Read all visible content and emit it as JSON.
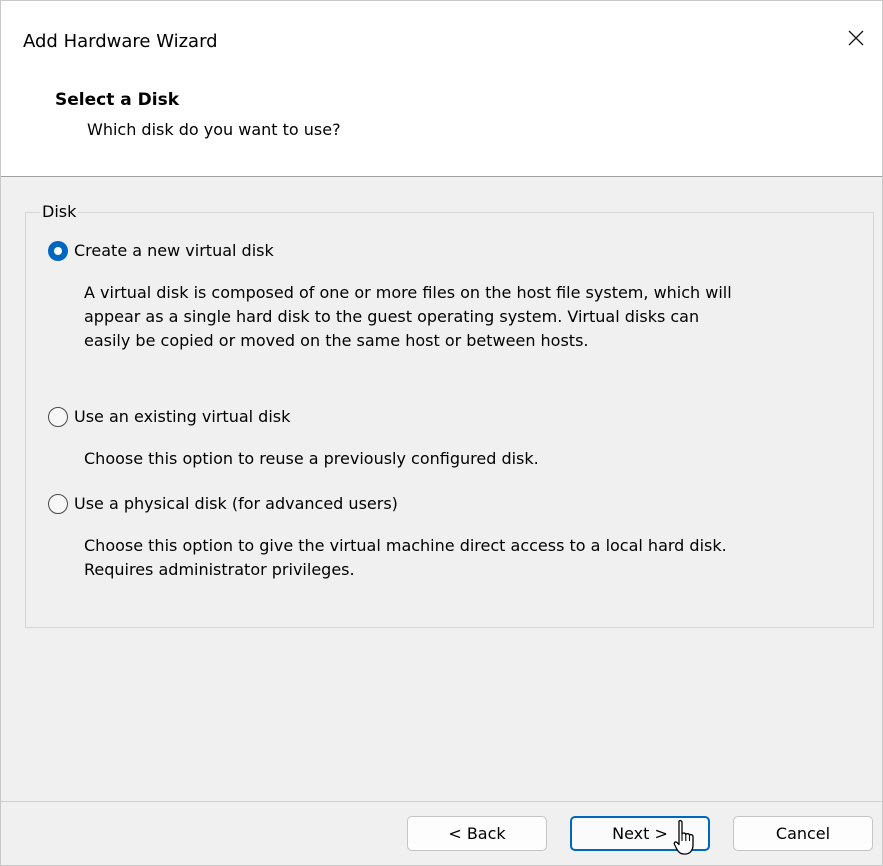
{
  "window": {
    "title": "Add Hardware Wizard"
  },
  "header": {
    "title": "Select a Disk",
    "subtitle": "Which disk do you want to use?"
  },
  "disk_group": {
    "label": "Disk",
    "options": [
      {
        "label": "Create a new virtual disk",
        "selected": true,
        "description_lines": [
          "A virtual disk is composed of one or more files on the host file system, which will",
          "appear as a single hard disk to the guest operating system. Virtual disks can",
          "easily be copied or moved on the same host or between hosts."
        ]
      },
      {
        "label": "Use an existing virtual disk",
        "selected": false,
        "description_lines": [
          "Choose this option to reuse a previously configured disk."
        ]
      },
      {
        "label": "Use a physical disk (for advanced users)",
        "selected": false,
        "description_lines": [
          "Choose this option to give the virtual machine direct access to a local hard disk.",
          "Requires administrator privileges."
        ]
      }
    ]
  },
  "buttons": {
    "back": "< Back",
    "next": "Next >",
    "cancel": "Cancel"
  },
  "icons": {
    "close": "close-icon",
    "cursor": "mouse-pointer-icon"
  },
  "colors": {
    "accent": "#0067c0"
  }
}
